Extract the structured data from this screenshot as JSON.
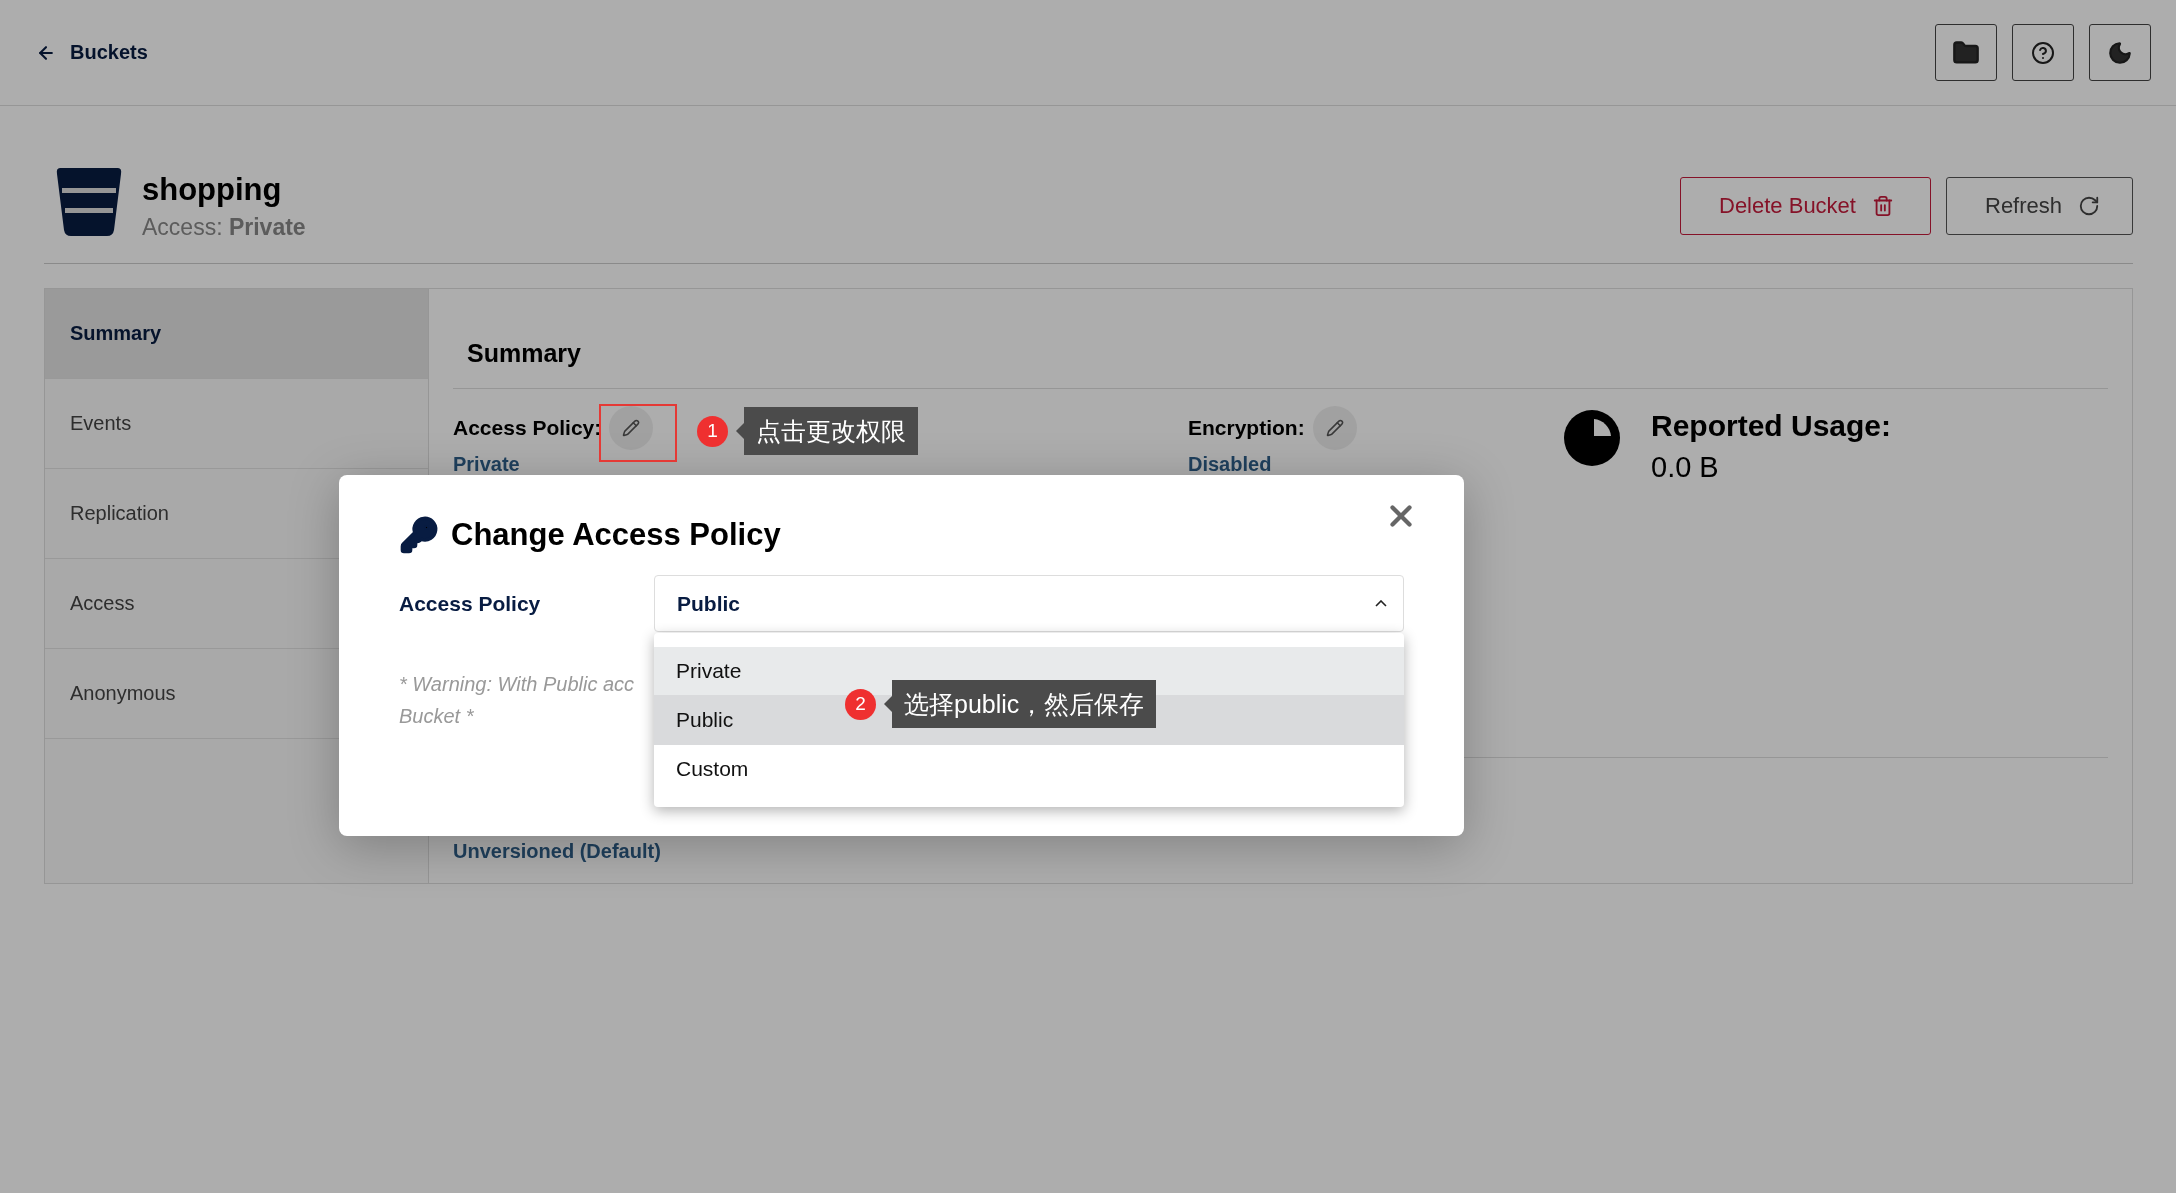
{
  "header": {
    "back_label": "Buckets"
  },
  "bucket": {
    "name": "shopping",
    "access_label": "Access:",
    "access_value": "Private"
  },
  "actions": [
    {
      "kind": "delete",
      "label": "Delete Bucket"
    },
    {
      "kind": "refresh",
      "label": "Refresh"
    }
  ],
  "sidebar": {
    "items": [
      {
        "label": "Summary",
        "selected": true
      },
      {
        "label": "Events",
        "selected": false
      },
      {
        "label": "Replication",
        "selected": false
      },
      {
        "label": "Access",
        "selected": false
      },
      {
        "label": "Anonymous",
        "selected": false
      }
    ]
  },
  "summary": {
    "title": "Summary",
    "access_policy": {
      "label": "Access Policy:",
      "value": "Private"
    },
    "encryption": {
      "label": "Encryption:",
      "value": "Disabled"
    },
    "usage": {
      "label": "Reported Usage:",
      "value": "0.0 B"
    },
    "versioning_value": "Unversioned (Default)"
  },
  "modal": {
    "title": "Change Access Policy",
    "field_label": "Access Policy",
    "select_value": "Public",
    "expanded": true,
    "options": [
      {
        "label": "Private",
        "selected": false,
        "hovered": true
      },
      {
        "label": "Public",
        "selected": true,
        "hovered": false
      },
      {
        "label": "Custom",
        "selected": false,
        "hovered": false
      }
    ],
    "warning_lines": [
      "* Warning: With Public acc",
      "Bucket *"
    ]
  },
  "annotations": [
    {
      "number": "1",
      "text": "点击更改权限"
    },
    {
      "number": "2",
      "text": "选择public，然后保存"
    }
  ]
}
